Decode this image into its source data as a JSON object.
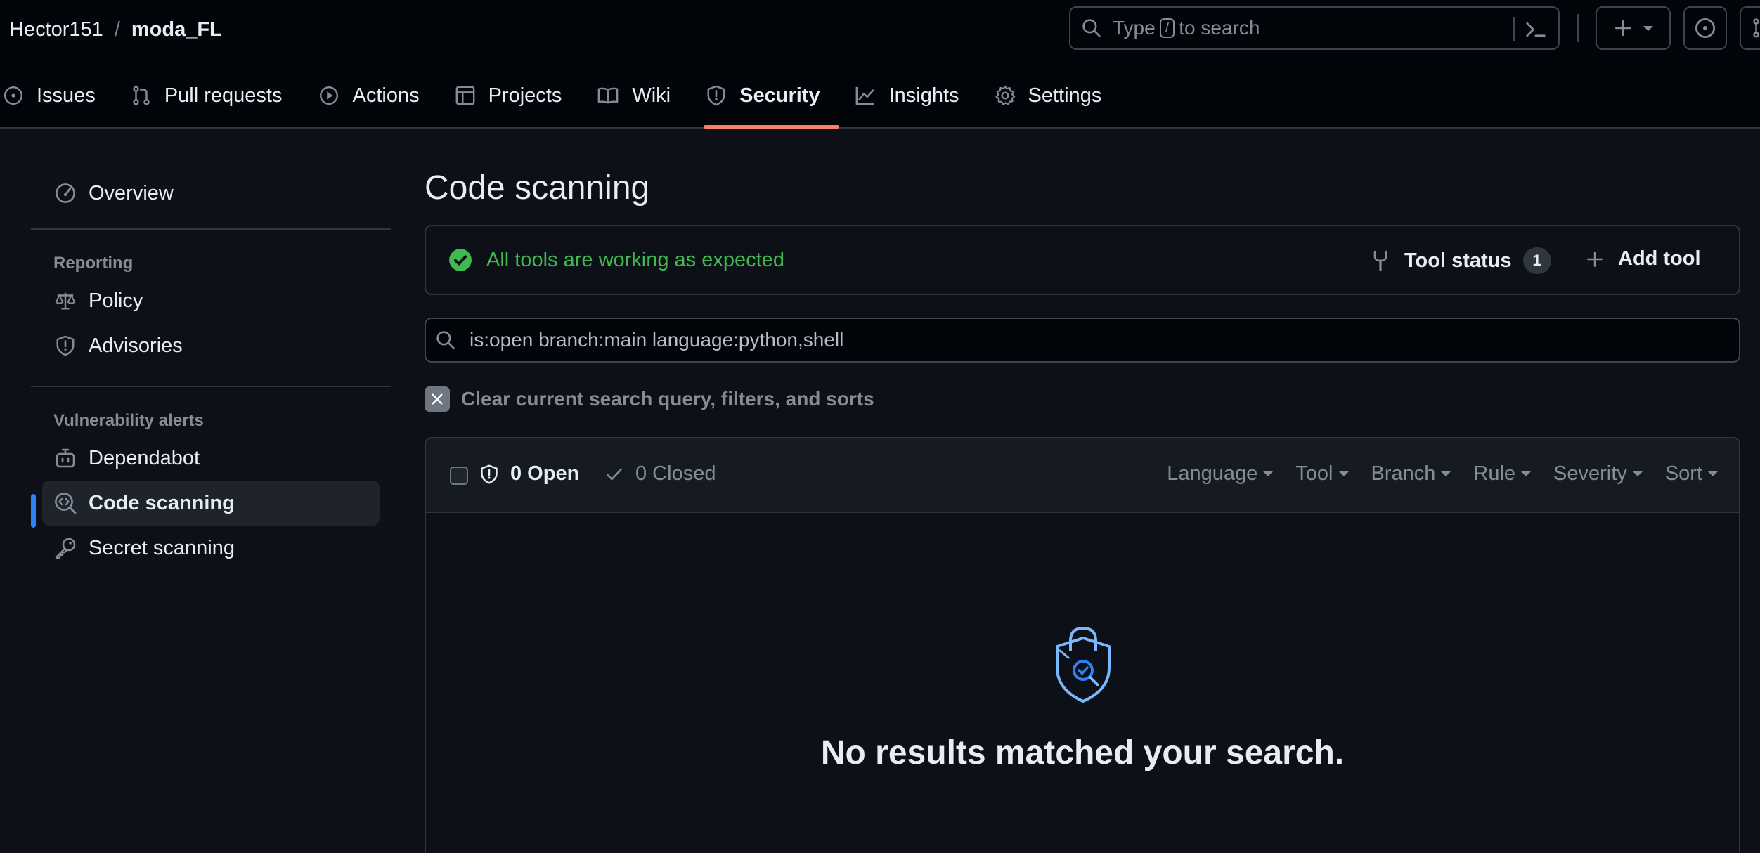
{
  "header": {
    "owner": "Hector151",
    "separator": "/",
    "repo": "moda_FL",
    "search": {
      "prefix": "Type",
      "key": "/",
      "suffix": "to search"
    }
  },
  "tabs": [
    {
      "label": "Issues",
      "icon": "issue-opened-icon"
    },
    {
      "label": "Pull requests",
      "icon": "git-pull-request-icon"
    },
    {
      "label": "Actions",
      "icon": "play-icon"
    },
    {
      "label": "Projects",
      "icon": "table-icon"
    },
    {
      "label": "Wiki",
      "icon": "book-icon"
    },
    {
      "label": "Security",
      "icon": "shield-icon",
      "active": true
    },
    {
      "label": "Insights",
      "icon": "graph-icon"
    },
    {
      "label": "Settings",
      "icon": "gear-icon"
    }
  ],
  "sidebar": {
    "overview": "Overview",
    "reporting_heading": "Reporting",
    "policy": "Policy",
    "advisories": "Advisories",
    "alerts_heading": "Vulnerability alerts",
    "dependabot": "Dependabot",
    "code_scanning": "Code scanning",
    "secret_scanning": "Secret scanning"
  },
  "main": {
    "title": "Code scanning",
    "status_text": "All tools are working as expected",
    "tool_status_label": "Tool status",
    "tool_status_count": "1",
    "add_tool_label": "Add tool",
    "filter_query": "is:open branch:main language:python,shell",
    "clear_label": "Clear current search query, filters, and sorts",
    "open_label": "0 Open",
    "closed_label": "0 Closed",
    "filters": [
      "Language",
      "Tool",
      "Branch",
      "Rule",
      "Severity",
      "Sort"
    ],
    "empty_message": "No results matched your search."
  },
  "colors": {
    "accent": "#2f81f7",
    "tab_underline": "#f78166",
    "success": "#3fb950",
    "background": "#0d1117"
  }
}
